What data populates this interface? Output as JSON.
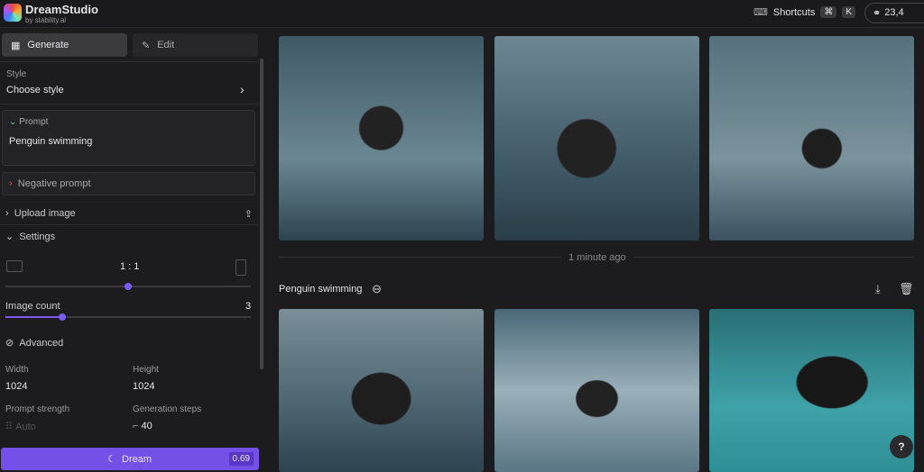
{
  "app": {
    "title": "DreamStudio",
    "subtitle": "by stability.ai"
  },
  "topbar": {
    "shortcuts": "Shortcuts",
    "key1": "⌘",
    "key2": "K",
    "credits": "23,4"
  },
  "sidebar": {
    "tabs": [
      {
        "label": "Generate",
        "active": true
      },
      {
        "label": "Edit",
        "active": false
      }
    ],
    "style": {
      "label": "Style",
      "value": "Choose style"
    },
    "prompt": {
      "label": "Prompt",
      "value": "Penguin swimming"
    },
    "negative_prompt": {
      "label": "Negative prompt"
    },
    "upload": {
      "label": "Upload image"
    },
    "settings": {
      "label": "Settings",
      "aspect": "1 : 1",
      "aspect_position": 0.5,
      "image_count_label": "Image count",
      "image_count": "3",
      "image_count_fraction": 0.2
    },
    "advanced": {
      "label": "Advanced",
      "width_label": "Width",
      "width": "1024",
      "height_label": "Height",
      "height": "1024",
      "strength_label": "Prompt strength",
      "strength": "Auto",
      "steps_label": "Generation steps",
      "steps": "40"
    },
    "dream": {
      "label": "Dream",
      "cost": "0.69"
    }
  },
  "main": {
    "timestamp": "1 minute ago",
    "batch_title": "Penguin swimming",
    "help": "?"
  },
  "colors": {
    "accent": "#7c5cf0",
    "water": "#4a6a7a",
    "teal": "#2f8f96"
  }
}
